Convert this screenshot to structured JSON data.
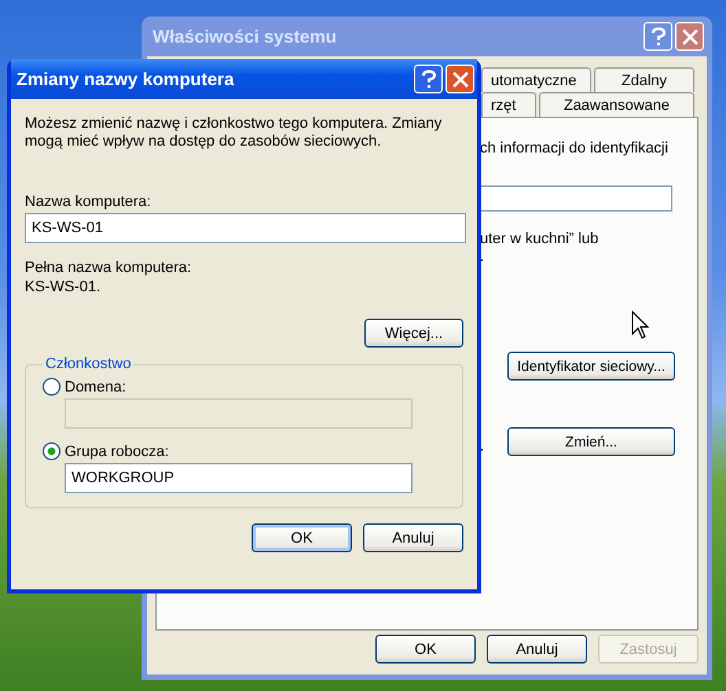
{
  "back_window": {
    "title": "Właściwości systemu",
    "tab_rows": [
      [
        {
          "label": "utomatyczne",
          "selected": false
        },
        {
          "label": "Zdalny",
          "selected": false
        }
      ],
      [
        {
          "label": "rzęt",
          "selected": false
        },
        {
          "label": "Zaawansowane",
          "selected": false
        }
      ]
    ],
    "text_1": "ch informacji do identyfikacji",
    "text_2": "uter w kuchni” lub",
    "text_3": ".",
    "network_id_button": "Identyfikator sieciowy...",
    "text_4": ".",
    "change_button": "Zmień...",
    "buttons": [
      {
        "label": "OK",
        "disabled": false
      },
      {
        "label": "Anuluj",
        "disabled": false
      },
      {
        "label": "Zastosuj",
        "disabled": true
      }
    ]
  },
  "dialog": {
    "title": "Zmiany nazwy komputera",
    "intro": "Możesz zmienić nazwę i członkostwo tego komputera. Zmiany mogą mieć wpływ na dostęp do zasobów sieciowych.",
    "name_label": "Nazwa komputera:",
    "name_value": "KS-WS-01",
    "full_name_label": "Pełna nazwa komputera:",
    "full_name_value": "KS-WS-01.",
    "more_button": "Więcej...",
    "membership": {
      "legend": "Członkostwo",
      "options": [
        {
          "label": "Domena:",
          "selected": false
        },
        {
          "label": "Grupa robocza:",
          "selected": true,
          "value": "WORKGROUP"
        }
      ]
    },
    "buttons": [
      {
        "label": "OK",
        "default": true
      },
      {
        "label": "Anuluj",
        "default": false
      }
    ]
  }
}
